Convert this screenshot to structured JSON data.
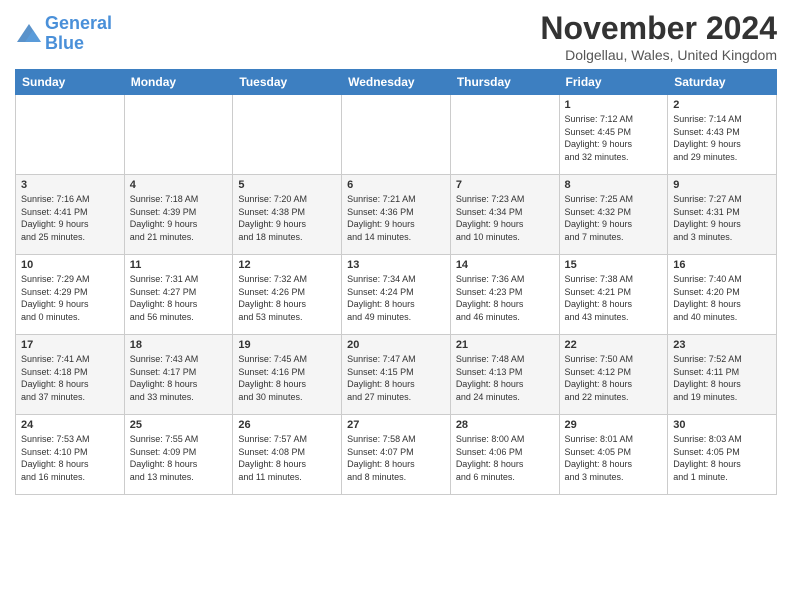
{
  "header": {
    "logo_line1": "General",
    "logo_line2": "Blue",
    "month": "November 2024",
    "location": "Dolgellau, Wales, United Kingdom"
  },
  "weekdays": [
    "Sunday",
    "Monday",
    "Tuesday",
    "Wednesday",
    "Thursday",
    "Friday",
    "Saturday"
  ],
  "weeks": [
    [
      {
        "day": "",
        "info": ""
      },
      {
        "day": "",
        "info": ""
      },
      {
        "day": "",
        "info": ""
      },
      {
        "day": "",
        "info": ""
      },
      {
        "day": "",
        "info": ""
      },
      {
        "day": "1",
        "info": "Sunrise: 7:12 AM\nSunset: 4:45 PM\nDaylight: 9 hours\nand 32 minutes."
      },
      {
        "day": "2",
        "info": "Sunrise: 7:14 AM\nSunset: 4:43 PM\nDaylight: 9 hours\nand 29 minutes."
      }
    ],
    [
      {
        "day": "3",
        "info": "Sunrise: 7:16 AM\nSunset: 4:41 PM\nDaylight: 9 hours\nand 25 minutes."
      },
      {
        "day": "4",
        "info": "Sunrise: 7:18 AM\nSunset: 4:39 PM\nDaylight: 9 hours\nand 21 minutes."
      },
      {
        "day": "5",
        "info": "Sunrise: 7:20 AM\nSunset: 4:38 PM\nDaylight: 9 hours\nand 18 minutes."
      },
      {
        "day": "6",
        "info": "Sunrise: 7:21 AM\nSunset: 4:36 PM\nDaylight: 9 hours\nand 14 minutes."
      },
      {
        "day": "7",
        "info": "Sunrise: 7:23 AM\nSunset: 4:34 PM\nDaylight: 9 hours\nand 10 minutes."
      },
      {
        "day": "8",
        "info": "Sunrise: 7:25 AM\nSunset: 4:32 PM\nDaylight: 9 hours\nand 7 minutes."
      },
      {
        "day": "9",
        "info": "Sunrise: 7:27 AM\nSunset: 4:31 PM\nDaylight: 9 hours\nand 3 minutes."
      }
    ],
    [
      {
        "day": "10",
        "info": "Sunrise: 7:29 AM\nSunset: 4:29 PM\nDaylight: 9 hours\nand 0 minutes."
      },
      {
        "day": "11",
        "info": "Sunrise: 7:31 AM\nSunset: 4:27 PM\nDaylight: 8 hours\nand 56 minutes."
      },
      {
        "day": "12",
        "info": "Sunrise: 7:32 AM\nSunset: 4:26 PM\nDaylight: 8 hours\nand 53 minutes."
      },
      {
        "day": "13",
        "info": "Sunrise: 7:34 AM\nSunset: 4:24 PM\nDaylight: 8 hours\nand 49 minutes."
      },
      {
        "day": "14",
        "info": "Sunrise: 7:36 AM\nSunset: 4:23 PM\nDaylight: 8 hours\nand 46 minutes."
      },
      {
        "day": "15",
        "info": "Sunrise: 7:38 AM\nSunset: 4:21 PM\nDaylight: 8 hours\nand 43 minutes."
      },
      {
        "day": "16",
        "info": "Sunrise: 7:40 AM\nSunset: 4:20 PM\nDaylight: 8 hours\nand 40 minutes."
      }
    ],
    [
      {
        "day": "17",
        "info": "Sunrise: 7:41 AM\nSunset: 4:18 PM\nDaylight: 8 hours\nand 37 minutes."
      },
      {
        "day": "18",
        "info": "Sunrise: 7:43 AM\nSunset: 4:17 PM\nDaylight: 8 hours\nand 33 minutes."
      },
      {
        "day": "19",
        "info": "Sunrise: 7:45 AM\nSunset: 4:16 PM\nDaylight: 8 hours\nand 30 minutes."
      },
      {
        "day": "20",
        "info": "Sunrise: 7:47 AM\nSunset: 4:15 PM\nDaylight: 8 hours\nand 27 minutes."
      },
      {
        "day": "21",
        "info": "Sunrise: 7:48 AM\nSunset: 4:13 PM\nDaylight: 8 hours\nand 24 minutes."
      },
      {
        "day": "22",
        "info": "Sunrise: 7:50 AM\nSunset: 4:12 PM\nDaylight: 8 hours\nand 22 minutes."
      },
      {
        "day": "23",
        "info": "Sunrise: 7:52 AM\nSunset: 4:11 PM\nDaylight: 8 hours\nand 19 minutes."
      }
    ],
    [
      {
        "day": "24",
        "info": "Sunrise: 7:53 AM\nSunset: 4:10 PM\nDaylight: 8 hours\nand 16 minutes."
      },
      {
        "day": "25",
        "info": "Sunrise: 7:55 AM\nSunset: 4:09 PM\nDaylight: 8 hours\nand 13 minutes."
      },
      {
        "day": "26",
        "info": "Sunrise: 7:57 AM\nSunset: 4:08 PM\nDaylight: 8 hours\nand 11 minutes."
      },
      {
        "day": "27",
        "info": "Sunrise: 7:58 AM\nSunset: 4:07 PM\nDaylight: 8 hours\nand 8 minutes."
      },
      {
        "day": "28",
        "info": "Sunrise: 8:00 AM\nSunset: 4:06 PM\nDaylight: 8 hours\nand 6 minutes."
      },
      {
        "day": "29",
        "info": "Sunrise: 8:01 AM\nSunset: 4:05 PM\nDaylight: 8 hours\nand 3 minutes."
      },
      {
        "day": "30",
        "info": "Sunrise: 8:03 AM\nSunset: 4:05 PM\nDaylight: 8 hours\nand 1 minute."
      }
    ]
  ]
}
